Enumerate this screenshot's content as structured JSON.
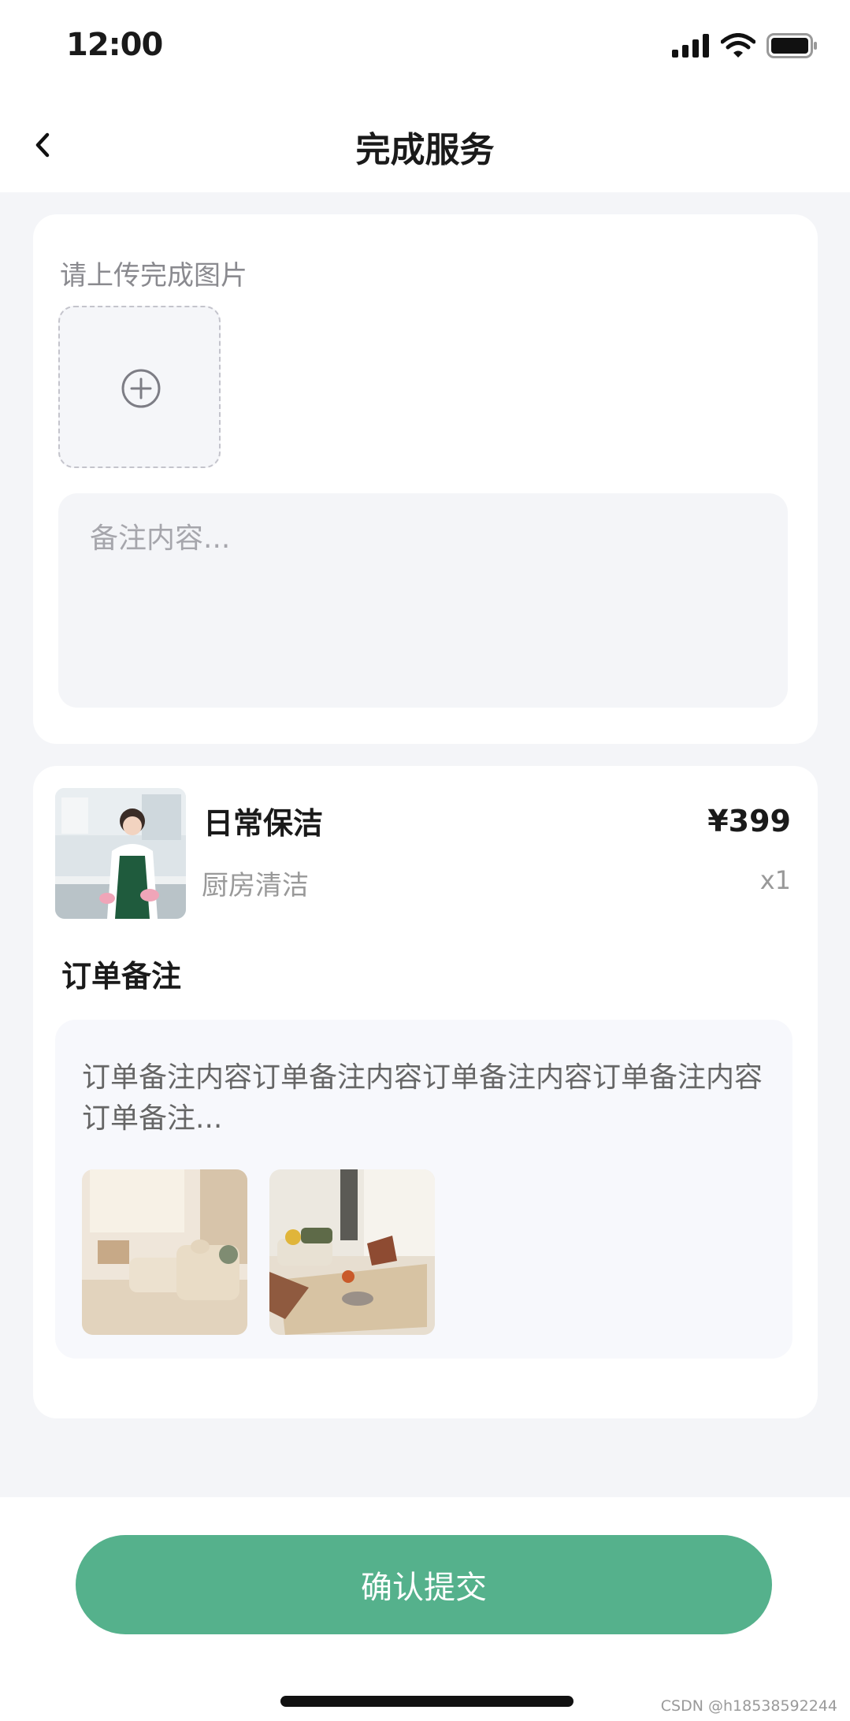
{
  "status_bar": {
    "time": "12:00"
  },
  "header": {
    "title": "完成服务"
  },
  "upload": {
    "label": "请上传完成图片",
    "remark_placeholder": "备注内容..."
  },
  "order": {
    "product_name": "日常保洁",
    "product_sub": "厨房清洁",
    "price": "¥399",
    "quantity": "x1",
    "note_title": "订单备注",
    "note_text": "订单备注内容订单备注内容订单备注内容订单备注内容订单备注..."
  },
  "footer": {
    "submit_label": "确认提交",
    "watermark": "CSDN @h18538592244"
  },
  "colors": {
    "accent": "#55b18c",
    "page_bg": "#f4f5f8"
  },
  "icons": [
    "back-chevron-icon",
    "plus-circle-icon",
    "signal-icon",
    "wifi-icon",
    "battery-icon"
  ]
}
